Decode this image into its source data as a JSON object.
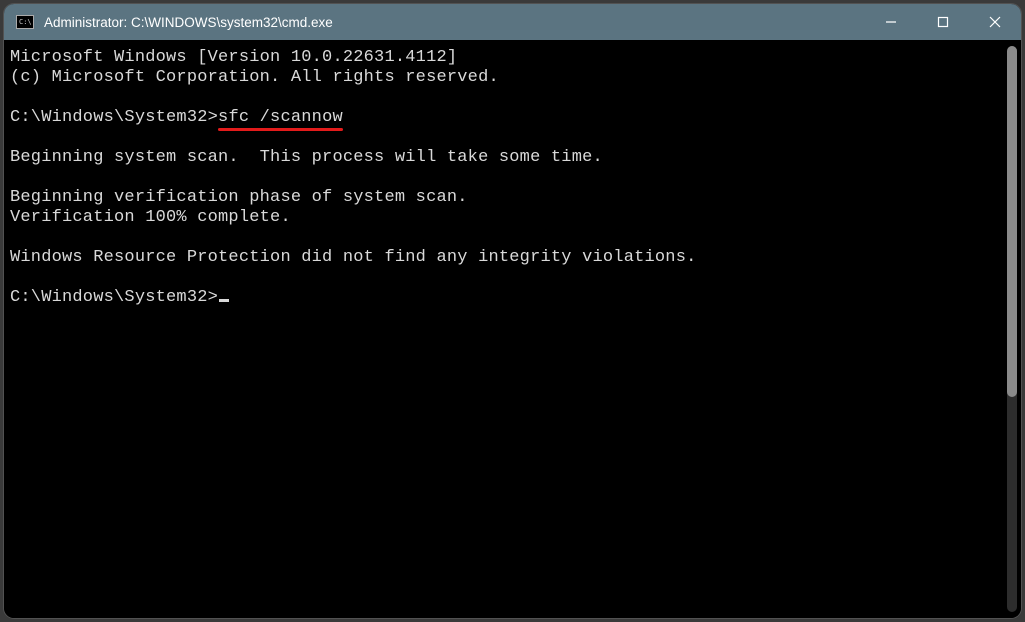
{
  "titlebar": {
    "icon_text": "C:\\",
    "title": "Administrator: C:\\WINDOWS\\system32\\cmd.exe"
  },
  "terminal": {
    "line_version": "Microsoft Windows [Version 10.0.22631.4112]",
    "line_copyright": "(c) Microsoft Corporation. All rights reserved.",
    "prompt1_path": "C:\\Windows\\System32>",
    "prompt1_cmd": "sfc /scannow",
    "line_begin_scan": "Beginning system scan.  This process will take some time.",
    "line_verification_phase": "Beginning verification phase of system scan.",
    "line_verification_done": "Verification 100% complete.",
    "line_result": "Windows Resource Protection did not find any integrity violations.",
    "prompt2_path": "C:\\Windows\\System32>"
  }
}
